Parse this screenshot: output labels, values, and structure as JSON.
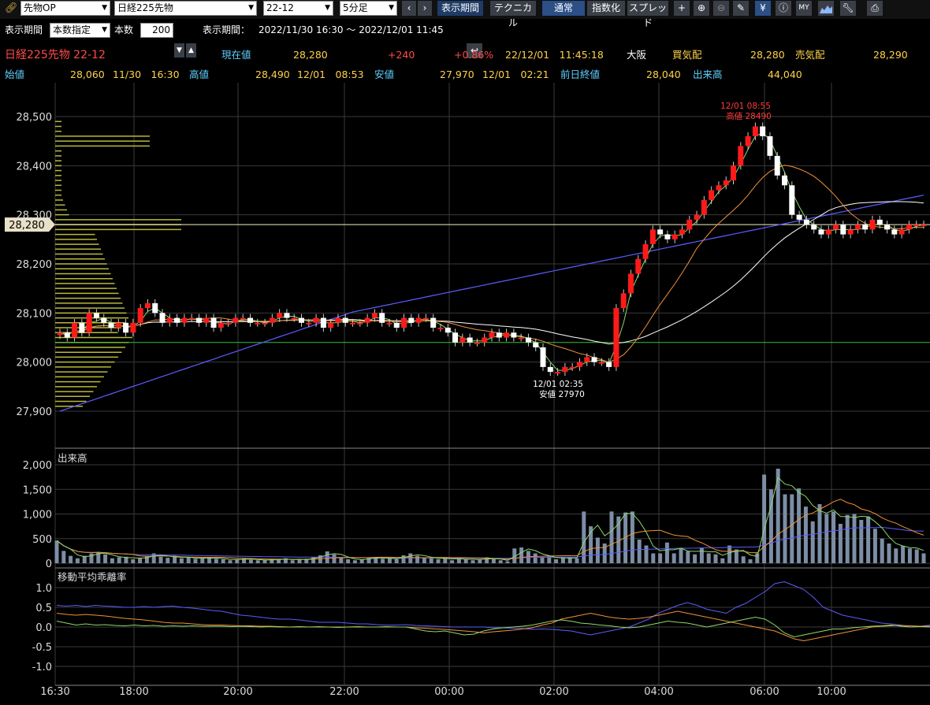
{
  "toolbar": {
    "product_type": "先物OP",
    "instrument": "日経225先物",
    "contract_month": "22-12",
    "interval": "5分足",
    "prev_icon": "chevron-left-icon",
    "next_icon": "chevron-right-icon",
    "period_button": "表示期間",
    "technical_button": "テクニカル",
    "normal_button": "通常",
    "index_button": "指数化",
    "spread_button": "スプレッド",
    "tool_icons": [
      "crosshair-icon",
      "zoom-in-icon",
      "zoom-out-icon",
      "pencil-icon",
      "yen-icon",
      "info-icon",
      "my-indicator-icon",
      "mountain-chart-icon",
      "wrench-icon",
      "print-icon"
    ]
  },
  "settings": {
    "period_label": "表示期間",
    "period_mode": "本数指定",
    "count_label": "本数",
    "count_value": "200",
    "range_label": "表示期間：",
    "range_value": "2022/11/30 16:30 ～ 2022/12/01 11:45"
  },
  "quote": {
    "name": "日経225先物 22-12",
    "current_label": "現在値",
    "current_value": "28,280",
    "change": "+240",
    "change_pct": "+0.86%",
    "time": "22/12/01　11:45:18",
    "exchange": "大阪",
    "bid_label": "買気配",
    "bid_value": "28,280",
    "ask_label": "売気配",
    "ask_value": "28,290",
    "open_label": "始値",
    "open_value": "28,060",
    "open_time": "11/30　16:30",
    "high_label": "高値",
    "high_value": "28,490",
    "high_time": "12/01　08:53",
    "low_label": "安値",
    "low_value": "27,970",
    "low_time": "12/01　02:21",
    "prev_close_label": "前日終値",
    "prev_close_value": "28,040",
    "volume_label": "出来高",
    "volume_value": "44,040"
  },
  "colors": {
    "up": "#ff1a1a",
    "down": "#ffffff",
    "ma_short": "#8ed86a",
    "ma_mid": "#f0913a",
    "ma_long": "#5c5cff",
    "ma_white": "#ffffff",
    "prev_close_line": "#36c036",
    "current_line": "#f3f0c0",
    "volume_bar": "#7c8ea6",
    "grid": "#3a3a3a",
    "profile": "#b8b83a"
  },
  "chart_data": [
    {
      "type": "candlestick",
      "title": "",
      "price_axis_ticks": [
        "28,500",
        "28,400",
        "28,300",
        "28,200",
        "28,100",
        "28,000",
        "27,900"
      ],
      "ylim": [
        27870,
        28570
      ],
      "x_tick_labels": [
        "16:30",
        "18:00",
        "20:00",
        "22:00",
        "00:00",
        "02:00",
        "04:00",
        "06:00",
        "10:00"
      ],
      "current_price_label": "28,280",
      "current_price": 28280,
      "prev_close": 28040,
      "high_annotation": [
        "12/01 08:55",
        "高値 28490"
      ],
      "low_annotation": [
        "12/01 02:35",
        "安値 27970"
      ],
      "close_series": [
        28060,
        28050,
        28080,
        28060,
        28100,
        28090,
        28080,
        28070,
        28080,
        28060,
        28080,
        28110,
        28120,
        28100,
        28080,
        28090,
        28080,
        28090,
        28090,
        28080,
        28090,
        28070,
        28080,
        28080,
        28090,
        28090,
        28080,
        28080,
        28080,
        28090,
        28100,
        28090,
        28090,
        28080,
        28080,
        28090,
        28070,
        28080,
        28090,
        28080,
        28080,
        28080,
        28090,
        28100,
        28080,
        28080,
        28070,
        28090,
        28080,
        28090,
        28090,
        28070,
        28070,
        28060,
        28040,
        28050,
        28040,
        28040,
        28050,
        28060,
        28050,
        28060,
        28050,
        28050,
        28040,
        28030,
        27990,
        27980,
        27980,
        27990,
        27990,
        28000,
        28010,
        28000,
        28000,
        27990,
        28110,
        28140,
        28180,
        28210,
        28240,
        28270,
        28260,
        28250,
        28260,
        28270,
        28290,
        28300,
        28330,
        28350,
        28360,
        28370,
        28400,
        28440,
        28460,
        28480,
        28460,
        28420,
        28380,
        28360,
        28300,
        28290,
        28280,
        28270,
        28260,
        28270,
        28280,
        28260,
        28270,
        28280,
        28270,
        28290,
        28280,
        28270,
        28260,
        28270,
        28280,
        28280,
        28280
      ]
    },
    {
      "type": "bar",
      "title": "出来高",
      "ylim": [
        0,
        2000
      ],
      "y_tick_labels": [
        "2,000",
        "1,500",
        "1,000",
        "500",
        "0"
      ],
      "values": [
        460,
        250,
        150,
        100,
        150,
        200,
        230,
        180,
        100,
        120,
        130,
        80,
        100,
        150,
        200,
        130,
        110,
        150,
        100,
        120,
        90,
        100,
        120,
        90,
        80,
        60,
        80,
        100,
        70,
        60,
        60,
        80,
        70,
        100,
        60,
        80,
        90,
        120,
        160,
        240,
        180,
        120,
        80,
        60,
        80,
        120,
        110,
        90,
        100,
        80,
        160,
        200,
        150,
        120,
        100,
        80,
        120,
        60,
        100,
        80,
        60,
        80,
        120,
        80,
        60,
        40,
        300,
        320,
        250,
        200,
        120,
        140,
        80,
        110,
        120,
        100,
        1050,
        750,
        520,
        400,
        1050,
        950,
        1030,
        1050,
        480,
        360,
        200,
        200,
        420,
        200,
        300,
        240,
        180,
        320,
        200,
        180,
        100,
        360,
        280,
        140,
        80,
        200,
        1800,
        1500,
        1920,
        1400,
        1400,
        1520,
        1150,
        850,
        1200,
        1000,
        1050,
        800,
        980,
        1000,
        880,
        950,
        700,
        500,
        400,
        300,
        350,
        300,
        280,
        200
      ]
    },
    {
      "type": "line",
      "title": "移動平均乖離率",
      "ylim": [
        -1.2,
        1.2
      ],
      "y_tick_labels": [
        "1.0",
        "0.5",
        "0.0",
        "-0.5",
        "-1.0"
      ],
      "series": [
        {
          "values": [
            0.55,
            0.53,
            0.55,
            0.52,
            0.55,
            0.53,
            0.52,
            0.5,
            0.5,
            0.52,
            0.5,
            0.52,
            0.53,
            0.5,
            0.48,
            0.45,
            0.42,
            0.4,
            0.35,
            0.3,
            0.28,
            0.25,
            0.22,
            0.2,
            0.2,
            0.18,
            0.15,
            0.12,
            0.12,
            0.12,
            0.1,
            0.08,
            0.08,
            0.06,
            0.05,
            0.05,
            0.06,
            0.04,
            0.03,
            0.02,
            0.01,
            0.0,
            0.0,
            0.0,
            0.0,
            -0.02,
            -0.02,
            -0.03,
            -0.04,
            -0.06,
            -0.05,
            -0.06,
            -0.08,
            -0.1,
            -0.15,
            -0.2,
            -0.15,
            -0.1,
            -0.05,
            0.0,
            0.1,
            0.2,
            0.35,
            0.45,
            0.55,
            0.62,
            0.55,
            0.45,
            0.4,
            0.35,
            0.5,
            0.6,
            0.75,
            0.9,
            1.1,
            1.15,
            1.05,
            0.95,
            0.75,
            0.5,
            0.4,
            0.3,
            0.25,
            0.2,
            0.15,
            0.1,
            0.08,
            0.05,
            0.0,
            0.02,
            0.05
          ]
        },
        {
          "values": [
            0.35,
            0.32,
            0.3,
            0.32,
            0.3,
            0.28,
            0.25,
            0.22,
            0.2,
            0.18,
            0.15,
            0.12,
            0.1,
            0.1,
            0.08,
            0.06,
            0.05,
            0.05,
            0.04,
            0.03,
            0.03,
            0.02,
            0.02,
            0.01,
            0.0,
            0.0,
            0.0,
            0.01,
            0.0,
            0.0,
            0.0,
            0.01,
            0.0,
            0.0,
            0.0,
            0.0,
            0.0,
            -0.02,
            -0.03,
            -0.05,
            -0.06,
            -0.08,
            -0.1,
            -0.12,
            -0.15,
            -0.12,
            -0.1,
            -0.08,
            -0.05,
            -0.02,
            0.05,
            0.1,
            0.2,
            0.25,
            0.3,
            0.35,
            0.3,
            0.25,
            0.22,
            0.2,
            0.22,
            0.25,
            0.3,
            0.35,
            0.4,
            0.35,
            0.3,
            0.25,
            0.2,
            0.15,
            0.1,
            0.05,
            0.0,
            -0.05,
            -0.1,
            -0.2,
            -0.3,
            -0.35,
            -0.3,
            -0.25,
            -0.2,
            -0.15,
            -0.1,
            -0.05,
            0.0,
            0.02,
            0.03,
            0.04,
            0.03,
            0.02,
            0.02
          ]
        },
        {
          "values": [
            0.15,
            0.1,
            0.05,
            0.08,
            0.05,
            0.06,
            0.04,
            0.03,
            0.05,
            0.03,
            0.04,
            0.02,
            0.03,
            0.02,
            0.03,
            0.02,
            0.02,
            0.02,
            0.01,
            0.02,
            0.01,
            0.0,
            0.01,
            0.0,
            0.0,
            0.01,
            0.0,
            0.0,
            0.0,
            -0.01,
            0.0,
            0.0,
            0.0,
            0.0,
            0.01,
            0.0,
            0.0,
            -0.05,
            -0.1,
            -0.12,
            -0.1,
            -0.15,
            -0.2,
            -0.18,
            -0.1,
            -0.05,
            -0.02,
            0.0,
            0.02,
            0.05,
            0.1,
            0.15,
            0.18,
            0.15,
            0.1,
            0.08,
            0.05,
            0.03,
            0.0,
            -0.02,
            0.0,
            0.05,
            0.1,
            0.15,
            0.12,
            0.1,
            0.05,
            0.0,
            0.05,
            0.1,
            0.15,
            0.2,
            0.25,
            0.2,
            0.05,
            -0.15,
            -0.25,
            -0.2,
            -0.15,
            -0.1,
            -0.05,
            -0.05,
            -0.02,
            0.0,
            0.02,
            0.03,
            0.05,
            0.02,
            0.0,
            0.01,
            0.0
          ]
        }
      ]
    }
  ]
}
